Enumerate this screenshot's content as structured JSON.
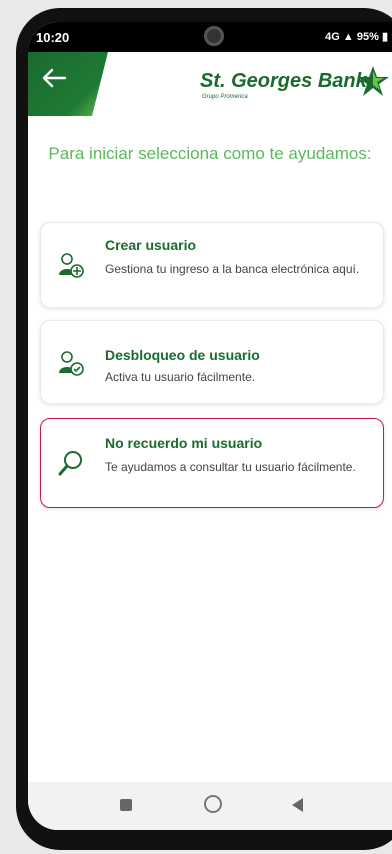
{
  "status": {
    "time": "10:20",
    "signal": "4G",
    "battery": "95%"
  },
  "header": {
    "bank_name": "St. Georges Bank",
    "bank_subtitle": "Grupo Promerica"
  },
  "title": "Para iniciar selecciona como te ayudamos:",
  "cards": [
    {
      "title": "Crear usuario",
      "desc": "Gestiona tu ingreso a la banca electrónica aquí."
    },
    {
      "title": "Desbloqueo de usuario",
      "desc": "Activa tu usuario fácilmente."
    },
    {
      "title": "No recuerdo mi usuario",
      "desc": "Te ayudamos a consultar tu usuario fácilmente."
    }
  ],
  "colors": {
    "brand_green": "#1b6a2e",
    "accent_green": "#5cb85c",
    "highlight": "#c2185b"
  }
}
